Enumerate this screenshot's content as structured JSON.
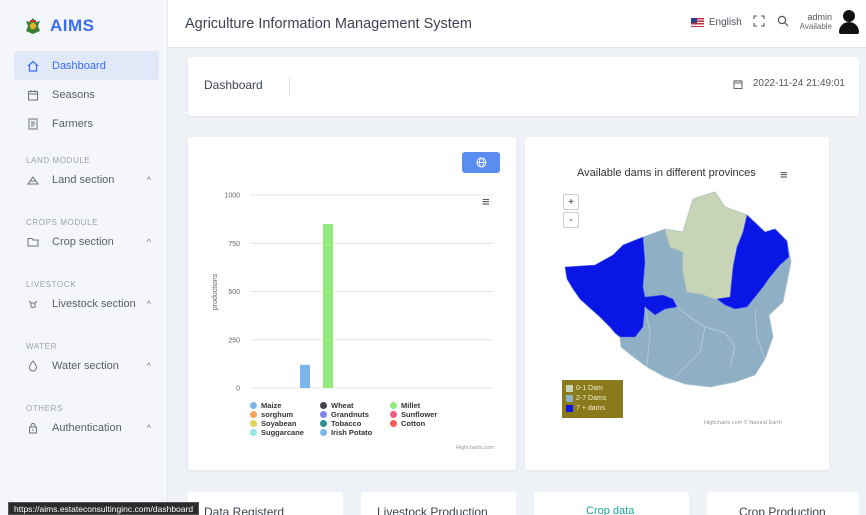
{
  "app": {
    "name": "AIMS",
    "title": "Agriculture Information Management System"
  },
  "header": {
    "language": "English",
    "user_name": "admin",
    "user_status": "Available"
  },
  "sidebar": {
    "items": [
      {
        "label": "Dashboard",
        "icon": "home-icon",
        "active": true
      },
      {
        "label": "Seasons",
        "icon": "calendar-icon"
      },
      {
        "label": "Farmers",
        "icon": "document-icon"
      }
    ],
    "sections": [
      {
        "heading": "LAND MODULE",
        "item": "Land section",
        "icon": "land-icon"
      },
      {
        "heading": "CROPS MODULE",
        "item": "Crop section",
        "icon": "folder-icon"
      },
      {
        "heading": "LIVESTOCK",
        "item": "Livestock section",
        "icon": "cow-icon"
      },
      {
        "heading": "WATER",
        "item": "Water section",
        "icon": "droplet-icon"
      },
      {
        "heading": "OTHERS",
        "item": "Authentication",
        "icon": "lock-icon"
      }
    ]
  },
  "breadcrumb": {
    "title": "Dashboard",
    "datetime": "2022-11-24 21:49:01"
  },
  "status_url": "https://aims.estateconsultinginc.com/dashboard",
  "chart_data": {
    "type": "bar",
    "title": "",
    "xlabel": "",
    "ylabel": "productions",
    "ylim": [
      0,
      1000
    ],
    "yticks": [
      0,
      250,
      500,
      750,
      1000
    ],
    "grid": true,
    "legend_position": "bottom",
    "series": [
      {
        "name": "Maize",
        "value": 120,
        "color": "#7cb5ec"
      },
      {
        "name": "Wheat",
        "value": 0,
        "color": "#434348"
      },
      {
        "name": "Millet",
        "value": 850,
        "color": "#90ed7d"
      },
      {
        "name": "sorghum",
        "value": 0,
        "color": "#f7a35c"
      },
      {
        "name": "Grandnuts",
        "value": 0,
        "color": "#8085e9"
      },
      {
        "name": "Sunflower",
        "value": 0,
        "color": "#f15c80"
      },
      {
        "name": "Soyabean",
        "value": 0,
        "color": "#e4d354"
      },
      {
        "name": "Tobacco",
        "value": 0,
        "color": "#2b908f"
      },
      {
        "name": "Cotton",
        "value": 0,
        "color": "#f45b5b"
      },
      {
        "name": "Suggarcane",
        "value": 0,
        "color": "#91e8e1"
      },
      {
        "name": "Irish Potato",
        "value": 0,
        "color": "#7cb5ec"
      }
    ],
    "credits": "Highcharts.com"
  },
  "map": {
    "title": "Available dams in different provinces",
    "zoom_in": "+",
    "zoom_out": "-",
    "legend": [
      {
        "label": "0-1 Dam",
        "color": "#c7d4b6"
      },
      {
        "label": "2-7 Dams",
        "color": "#8fb0c4"
      },
      {
        "label": "7 + dams",
        "color": "#0a16e6"
      }
    ],
    "credits": "Highcharts.com © Natural Earth"
  },
  "bottom_cards": [
    "Data Registerd",
    "Livestock Production",
    "Crop data",
    "Crop Production"
  ]
}
